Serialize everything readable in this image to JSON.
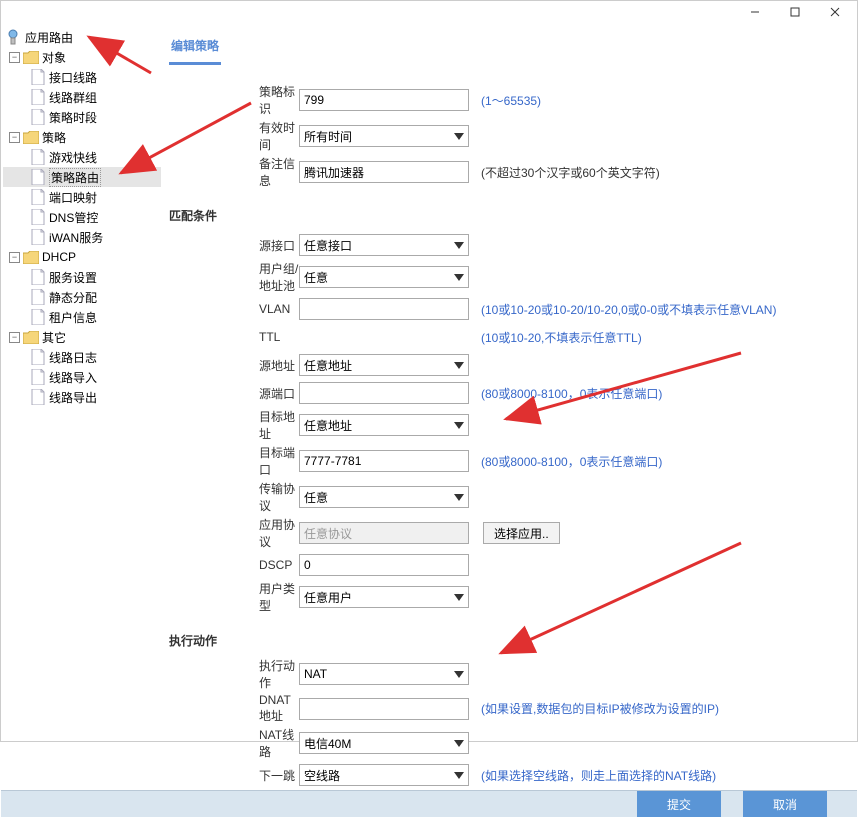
{
  "window": {
    "title": "应用路由"
  },
  "tree": {
    "root": "应用路由",
    "groups": [
      {
        "label": "对象",
        "children": [
          "接口线路",
          "线路群组",
          "策略时段"
        ]
      },
      {
        "label": "策略",
        "children": [
          "游戏快线",
          "策略路由",
          "端口映射",
          "DNS管控",
          "iWAN服务"
        ],
        "selected": "策略路由"
      },
      {
        "label": "DHCP",
        "children": [
          "服务设置",
          "静态分配",
          "租户信息"
        ]
      },
      {
        "label": "其它",
        "children": [
          "线路日志",
          "线路导入",
          "线路导出"
        ]
      }
    ]
  },
  "tab": {
    "label": "编辑策略"
  },
  "top": {
    "policy_id_label": "策略标识",
    "policy_id_value": "799",
    "policy_id_hint": "(1～65535)",
    "time_label": "有效时间",
    "time_value": "所有时间",
    "remark_label": "备注信息",
    "remark_value": "腾讯加速器",
    "remark_hint": "(不超过30个汉字或60个英文字符)"
  },
  "match": {
    "title": "匹配条件",
    "src_if_label": "源接口",
    "src_if_value": "任意接口",
    "group_label": "用户组/地址池",
    "group_value": "任意",
    "vlan_label": "VLAN",
    "vlan_value": "",
    "vlan_hint": "(10或10-20或10-20/10-20,0或0-0或不填表示任意VLAN)",
    "ttl_label": "TTL",
    "ttl_hint": "(10或10-20,不填表示任意TTL)",
    "src_addr_label": "源地址",
    "src_addr_value": "任意地址",
    "src_port_label": "源端口",
    "src_port_value": "",
    "src_port_hint": "(80或8000-8100，0表示任意端口)",
    "dst_addr_label": "目标地址",
    "dst_addr_value": "任意地址",
    "dst_port_label": "目标端口",
    "dst_port_value": "7777-7781",
    "dst_port_hint": "(80或8000-8100，0表示任意端口)",
    "proto_label": "传输协议",
    "proto_value": "任意",
    "appproto_label": "应用协议",
    "appproto_value": "任意协议",
    "appproto_btn": "选择应用..",
    "dscp_label": "DSCP",
    "dscp_value": "0",
    "usertype_label": "用户类型",
    "usertype_value": "任意用户"
  },
  "action": {
    "title": "执行动作",
    "action_label": "执行动作",
    "action_value": "NAT",
    "dnat_label": "DNAT地址",
    "dnat_value": "",
    "dnat_hint": "(如果设置,数据包的目标IP被修改为设置的IP)",
    "natline_label": "NAT线路",
    "natline_value": "电信40M",
    "nexthop_label": "下一跳",
    "nexthop_value": "空线路",
    "nexthop_hint": "(如果选择空线路，则走上面选择的NAT线路)"
  },
  "footer": {
    "submit": "提交",
    "cancel": "取消"
  }
}
